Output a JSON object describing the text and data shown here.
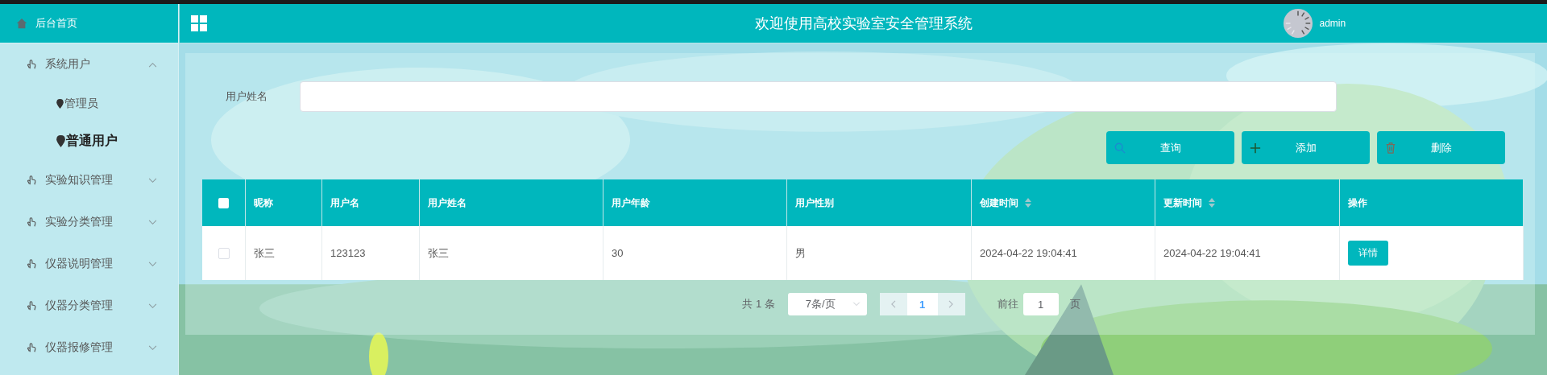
{
  "sidebar": {
    "home": "后台首页",
    "menus": [
      {
        "label": "系统用户",
        "expanded": true,
        "children": [
          {
            "label": "管理员",
            "selected": false
          },
          {
            "label": "普通用户",
            "selected": true
          }
        ]
      },
      {
        "label": "实验知识管理",
        "expanded": false
      },
      {
        "label": "实验分类管理",
        "expanded": false
      },
      {
        "label": "仪器说明管理",
        "expanded": false
      },
      {
        "label": "仪器分类管理",
        "expanded": false
      },
      {
        "label": "仪器报修管理",
        "expanded": false
      }
    ]
  },
  "header": {
    "title": "欢迎使用高校实验室安全管理系统",
    "user": "admin"
  },
  "search": {
    "label": "用户姓名"
  },
  "buttons": [
    {
      "label": "查询",
      "kind": "search"
    },
    {
      "label": "添加",
      "kind": "add"
    },
    {
      "label": "删除",
      "kind": "delete"
    }
  ],
  "table": {
    "all_checked": false,
    "columns": [
      {
        "label": "昵称",
        "sortable": false
      },
      {
        "label": "用户名",
        "sortable": false
      },
      {
        "label": "用户姓名",
        "sortable": false
      },
      {
        "label": "用户年龄",
        "sortable": false
      },
      {
        "label": "用户性别",
        "sortable": false
      },
      {
        "label": "创建时间",
        "sortable": true
      },
      {
        "label": "更新时间",
        "sortable": true
      },
      {
        "label": "操作",
        "sortable": false
      }
    ],
    "rows": [
      {
        "checked": false,
        "cells": [
          "张三",
          "123123",
          "张三",
          "30",
          "男",
          "2024-04-22 19:04:41",
          "2024-04-22 19:04:41"
        ],
        "action": "详情"
      }
    ]
  },
  "pagination": {
    "total": "共 1 条",
    "page_size": "7条/页",
    "pages": [
      {
        "label": "1",
        "selected": true
      }
    ],
    "goto_label": "前往",
    "goto_value": "1",
    "page_unit": "页"
  }
}
